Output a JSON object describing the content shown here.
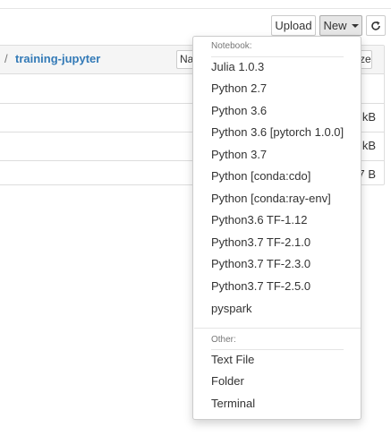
{
  "toolbar": {
    "upload_label": "Upload",
    "new_label": "New",
    "refresh_icon": "refresh-icon"
  },
  "breadcrumb": {
    "separator": "/",
    "folder": "training-jupyter"
  },
  "list": {
    "sort_left_label": "Na",
    "sort_right_label": "ze",
    "rows": [
      {
        "size": "kB"
      },
      {
        "size": "kB"
      },
      {
        "size": "7 B"
      }
    ]
  },
  "new_menu": {
    "notebook_header": "Notebook:",
    "kernels": [
      "Julia 1.0.3",
      "Python 2.7",
      "Python 3.6",
      "Python 3.6 [pytorch 1.0.0]",
      "Python 3.7",
      "Python [conda:cdo]",
      "Python [conda:ray-env]",
      "Python3.6 TF-1.12",
      "Python3.7 TF-2.1.0",
      "Python3.7 TF-2.3.0",
      "Python3.7 TF-2.5.0",
      "pyspark"
    ],
    "other_header": "Other:",
    "other_items": [
      "Text File",
      "Folder",
      "Terminal"
    ]
  }
}
